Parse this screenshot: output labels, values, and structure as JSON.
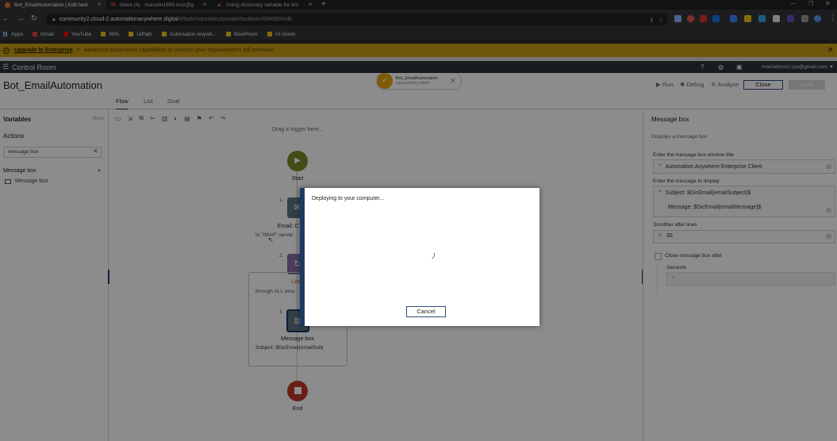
{
  "browser": {
    "tabs": [
      {
        "title": "Bot_EmailAutomation | Edit task",
        "active": true
      },
      {
        "title": "Inbox (4) - marcelo1999.cruz@g",
        "active": false
      },
      {
        "title": "Using dictionary variable for em",
        "active": false
      }
    ],
    "new_tab": "+",
    "url_host": "community2.cloud-2.automationanywhere.digital",
    "url_path": "/#/bots/repository/private/taskbots/654960/edit",
    "bookmarks": [
      "Apps",
      "Gmail",
      "YouTube",
      "RPA",
      "UiPath",
      "Automation Anywh...",
      "BluePrism",
      "UI.Vision"
    ]
  },
  "banner": {
    "link": "Upgrade to Enterprise",
    "message": "Advanced automation capabilities to unleash your organization's full potential"
  },
  "control_room": {
    "title": "Control Room",
    "user": "marcelocruz.rpa@gmail.com"
  },
  "bot": {
    "name": "Bot_EmailAutomation",
    "view_tabs": [
      "Flow",
      "List",
      "Dual"
    ],
    "actions": {
      "run": "Run",
      "debug": "Debug",
      "analyze": "Analyze",
      "close": "Close",
      "save": "Save"
    }
  },
  "toast": {
    "title": "Bot_EmailAutomation",
    "subtitle": "successfully edited"
  },
  "left_panel": {
    "variables": "Variables",
    "show": "Show",
    "actions": "Actions",
    "search_value": "message box",
    "group": "Message box",
    "item": "Message box"
  },
  "canvas": {
    "trigger_hint": "Drag a trigger here...",
    "start": "Start",
    "step1_num": "1.",
    "step1_label": "Email: C",
    "step1_sub": "to \"IMAP\" server",
    "step2_num": "2.",
    "step2_label": "Loo",
    "step2_sub": "through ALL ema",
    "step3_num": "3.",
    "step3_label": "Message box",
    "step3_sub": "Subject: $DicEmail{emailSubj",
    "end": "End"
  },
  "right_panel": {
    "title": "Message box",
    "description": "Displays a message box",
    "window_title_label": "Enter the message box window title",
    "window_title_value": "Automation Anywhere Enterprise Client",
    "message_label": "Enter the message to display",
    "message_line1": "Subject: $DicEmail{emailSubject}$",
    "message_line2": "Message: $DicEmail{emailMessage}$",
    "scrollbar_label": "Scrollbar after lines",
    "scrollbar_value": "30",
    "close_after_label": "Close message box after",
    "seconds_label": "Seconds"
  },
  "modal": {
    "message": "Deploying to your computer...",
    "cancel": "Cancel"
  },
  "colors": {
    "banner": "#c99d14",
    "control_room_bar": "#2d3438",
    "start_node": "#7c8a27",
    "end_node": "#c0392b",
    "modal_accent": "#1d3a63",
    "toast_check": "#e8a50f"
  }
}
